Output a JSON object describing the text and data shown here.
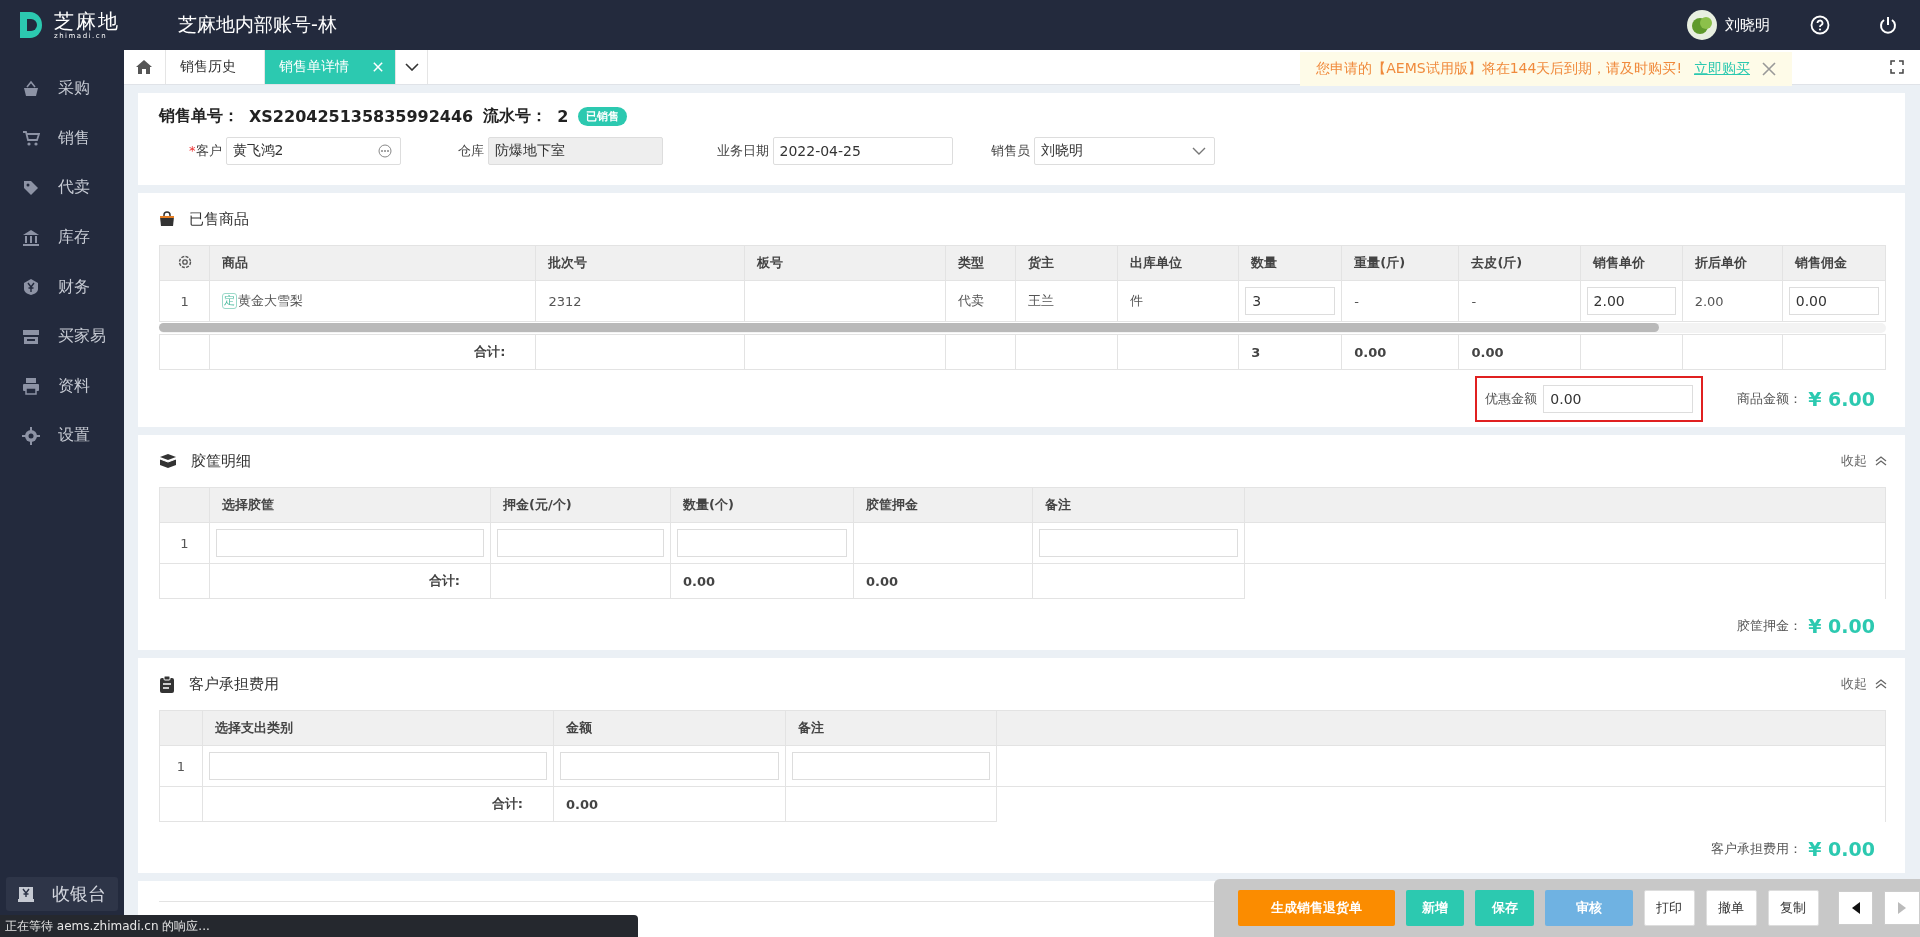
{
  "topbar": {
    "logo_text": "芝麻地",
    "logo_sub": "zhimadi.cn",
    "title": "芝麻地内部账号-林",
    "user": "刘晓明"
  },
  "sidebar": {
    "items": [
      {
        "label": "采购"
      },
      {
        "label": "销售"
      },
      {
        "label": "代卖"
      },
      {
        "label": "库存"
      },
      {
        "label": "财务"
      },
      {
        "label": "买家易"
      },
      {
        "label": "资料"
      },
      {
        "label": "设置"
      }
    ],
    "cashier": "收银台"
  },
  "tabs": [
    {
      "label": "销售历史",
      "selected": false
    },
    {
      "label": "销售单详情",
      "selected": true
    }
  ],
  "notice": {
    "text": "您申请的【AEMS试用版】将在144天后到期，请及时购买!",
    "link": "立即购买"
  },
  "order": {
    "no_label": "销售单号：",
    "no": "XS220425135835992446",
    "serial_label": "流水号：",
    "serial": "2",
    "status": "已销售",
    "fields": [
      {
        "label": "客户",
        "value": "黄飞鸿2",
        "required_mark": "*",
        "kind": "lookup"
      },
      {
        "label": "仓库",
        "value": "防爆地下室",
        "kind": "readonly"
      },
      {
        "label": "业务日期",
        "value": "2022-04-25",
        "kind": "date"
      },
      {
        "label": "销售员",
        "value": "刘晓明",
        "kind": "select"
      }
    ]
  },
  "sold_goods": {
    "title": "已售商品",
    "columns": [
      "商品",
      "批次号",
      "板号",
      "类型",
      "货主",
      "出库单位",
      "数量",
      "重量(斤)",
      "去皮(斤)",
      "销售单价",
      "折后单价",
      "销售佣金"
    ],
    "rows": [
      {
        "index": "1",
        "cells": [
          {
            "kind": "product",
            "tag": "定",
            "value": "黄金大雪梨"
          },
          {
            "kind": "text",
            "value": "2312"
          },
          {
            "kind": "blank"
          },
          {
            "kind": "text",
            "value": "代卖"
          },
          {
            "kind": "text",
            "value": "王兰"
          },
          {
            "kind": "text",
            "value": "件"
          },
          {
            "kind": "input",
            "value": "3"
          },
          {
            "kind": "text",
            "value": "-"
          },
          {
            "kind": "text",
            "value": "-"
          },
          {
            "kind": "input",
            "value": "2.00"
          },
          {
            "kind": "text",
            "value": "2.00"
          },
          {
            "kind": "input",
            "value": "0.00"
          }
        ]
      }
    ],
    "totals": [
      {
        "kind": "label",
        "text": "合计:"
      },
      {
        "kind": "blank"
      },
      {
        "kind": "blank"
      },
      {
        "kind": "blank"
      },
      {
        "kind": "blank"
      },
      {
        "kind": "blank"
      },
      {
        "kind": "value",
        "text": "3"
      },
      {
        "kind": "value",
        "text": "0.00"
      },
      {
        "kind": "value",
        "text": "0.00"
      },
      {
        "kind": "blank"
      },
      {
        "kind": "blank"
      },
      {
        "kind": "blank"
      }
    ],
    "discount": {
      "label": "优惠金额",
      "value": "0.00"
    },
    "summary": {
      "label": "商品金额：",
      "value": "¥ 6.00"
    }
  },
  "crates": {
    "title": "胶筐明细",
    "collapse": "收起",
    "columns": [
      "选择胶筐",
      "押金(元/个)",
      "数量(个)",
      "胶筐押金",
      "备注"
    ],
    "rows": [
      {
        "index": "1",
        "cells": [
          {
            "kind": "input"
          },
          {
            "kind": "input"
          },
          {
            "kind": "input"
          },
          {
            "kind": "blank"
          },
          {
            "kind": "input"
          }
        ]
      }
    ],
    "totals": [
      {
        "kind": "label",
        "text": "合计:"
      },
      {
        "kind": "blank"
      },
      {
        "kind": "value",
        "text": "0.00"
      },
      {
        "kind": "value",
        "text": "0.00"
      },
      {
        "kind": "blank"
      }
    ],
    "summary": {
      "label": "胶筐押金：",
      "value": "¥ 0.00"
    }
  },
  "fees": {
    "title": "客户承担费用",
    "collapse": "收起",
    "columns": [
      "选择支出类别",
      "金额",
      "备注"
    ],
    "rows": [
      {
        "index": "1",
        "cells": [
          {
            "kind": "input"
          },
          {
            "kind": "input"
          },
          {
            "kind": "input"
          }
        ]
      }
    ],
    "totals": [
      {
        "kind": "label",
        "text": "合计:"
      },
      {
        "kind": "value",
        "text": "0.00"
      },
      {
        "kind": "blank"
      }
    ],
    "summary": {
      "label": "客户承担费用：",
      "value": "¥ 0.00"
    }
  },
  "actions": [
    {
      "label": "生成销售退货单",
      "kind": "warning"
    },
    {
      "label": "新增",
      "kind": "primary"
    },
    {
      "label": "保存",
      "kind": "primary"
    },
    {
      "label": "审核",
      "kind": "info"
    },
    {
      "label": "打印",
      "kind": "plain"
    },
    {
      "label": "撤单",
      "kind": "plain"
    },
    {
      "label": "复制",
      "kind": "plain"
    }
  ],
  "status_text": "正在等待 aems.zhimadi.cn 的响应..."
}
